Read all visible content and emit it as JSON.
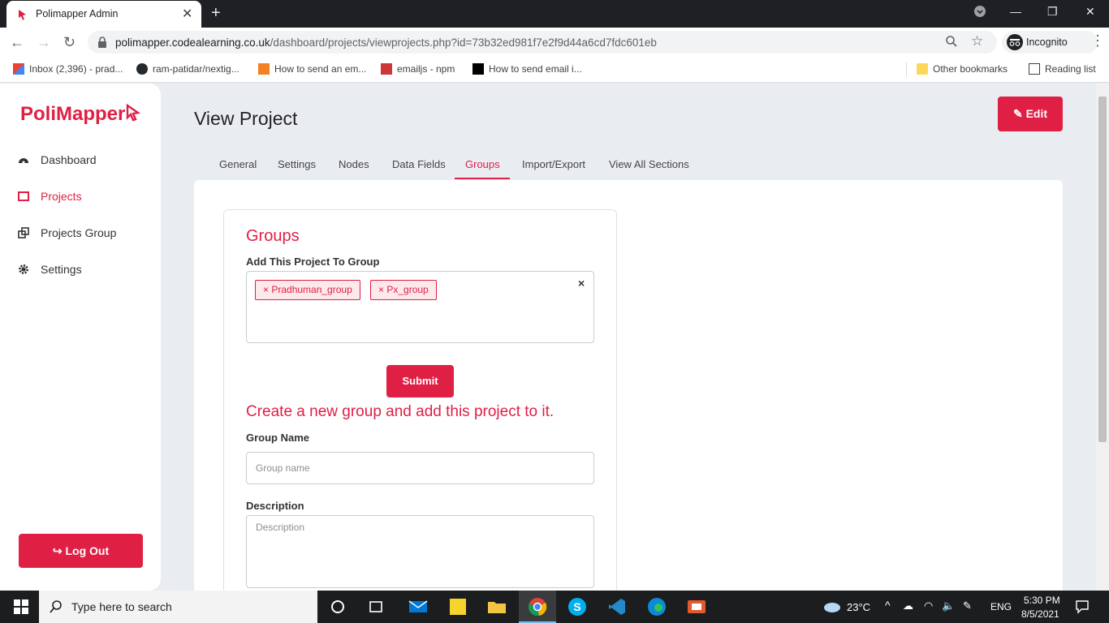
{
  "browser": {
    "tab_title": "Polimapper Admin",
    "url_host": "polimapper.codealearning.co.uk",
    "url_path": "/dashboard/projects/viewprojects.php?id=73b32ed981f7e2f9d44a6cd7fdc601eb",
    "profile_label": "Incognito",
    "bookmarks": [
      {
        "label": "Inbox (2,396) - prad..."
      },
      {
        "label": "ram-patidar/nextig..."
      },
      {
        "label": "How to send an em..."
      },
      {
        "label": "emailjs - npm"
      },
      {
        "label": "How to send email i..."
      }
    ],
    "other_bookmarks": "Other bookmarks",
    "reading_list": "Reading list"
  },
  "sidebar": {
    "logo": "PoliMapper",
    "items": [
      {
        "label": "Dashboard",
        "icon": "dashboard-icon"
      },
      {
        "label": "Projects",
        "icon": "projects-icon"
      },
      {
        "label": "Projects Group",
        "icon": "projects-group-icon"
      },
      {
        "label": "Settings",
        "icon": "gear-icon"
      }
    ],
    "logout": "Log Out"
  },
  "page": {
    "title": "View Project",
    "edit": "Edit",
    "tabs": [
      "General",
      "Settings",
      "Nodes",
      "Data Fields",
      "Groups",
      "Import/Export",
      "View All Sections"
    ],
    "active_tab": "Groups"
  },
  "groups": {
    "heading": "Groups",
    "add_label": "Add This Project To Group",
    "selected": [
      "Pradhuman_group",
      "Px_group"
    ],
    "submit": "Submit",
    "create_heading": "Create a new group and add this project to it.",
    "group_name_label": "Group Name",
    "group_name_placeholder": "Group name",
    "description_label": "Description",
    "description_placeholder": "Description"
  },
  "taskbar": {
    "search_placeholder": "Type here to search",
    "weather": "23°C",
    "lang": "ENG",
    "time": "5:30 PM",
    "date": "8/5/2021"
  },
  "colors": {
    "accent": "#e01f44"
  }
}
